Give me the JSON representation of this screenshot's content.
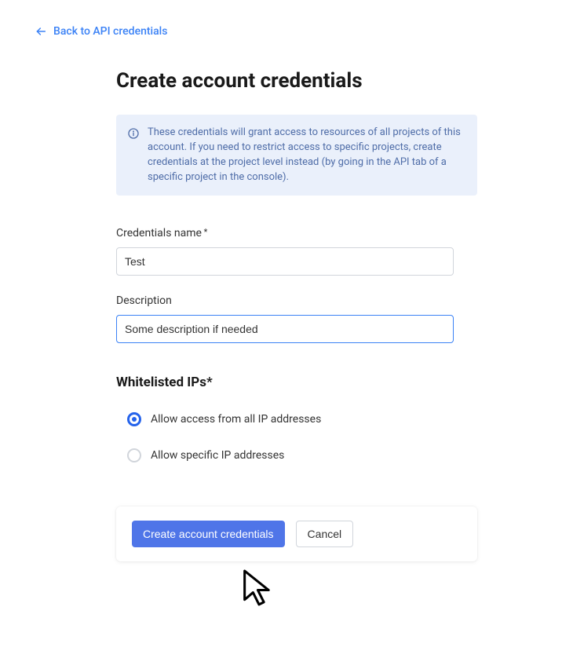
{
  "back_link": "Back to API credentials",
  "title": "Create account credentials",
  "info": "These credentials will grant access to resources of all projects of this account. If you need to restrict access to specific projects, create credentials at the project level instead (by going in the API tab of a specific project in the console).",
  "fields": {
    "name": {
      "label": "Credentials name",
      "value": "Test"
    },
    "description": {
      "label": "Description",
      "value": "Some description if needed"
    }
  },
  "whitelist": {
    "title": "Whitelisted IPs*",
    "options": [
      {
        "label": "Allow access from all IP addresses",
        "checked": true
      },
      {
        "label": "Allow specific IP addresses",
        "checked": false
      }
    ]
  },
  "actions": {
    "primary": "Create account credentials",
    "secondary": "Cancel"
  }
}
